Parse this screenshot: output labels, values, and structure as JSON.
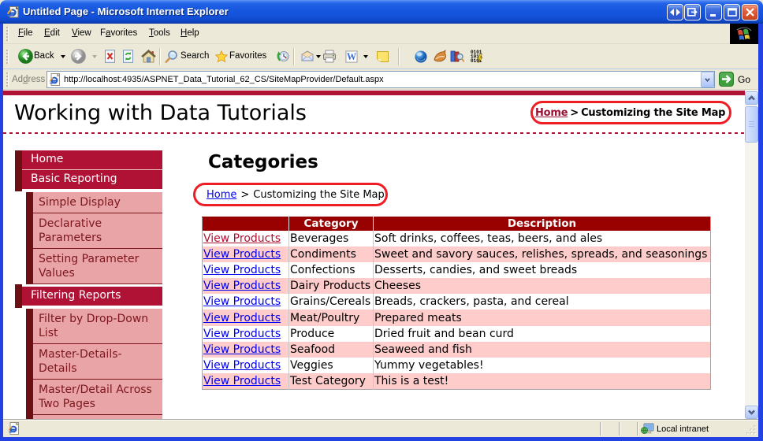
{
  "window": {
    "title": "Untitled Page - Microsoft Internet Explorer",
    "buttons": [
      "resize-horizontal",
      "detach",
      "minimize",
      "maximize",
      "close"
    ]
  },
  "menu": {
    "items": [
      {
        "label": "File",
        "accel": 0
      },
      {
        "label": "Edit",
        "accel": 0
      },
      {
        "label": "View",
        "accel": 0
      },
      {
        "label": "Favorites",
        "accel": 1
      },
      {
        "label": "Tools",
        "accel": 0
      },
      {
        "label": "Help",
        "accel": 0
      }
    ]
  },
  "toolbar": {
    "back_label": "Back",
    "search_label": "Search",
    "favorites_label": "Favorites"
  },
  "address": {
    "label": "Address",
    "label_accel": 2,
    "url": "http://localhost:4935/ASPNET_Data_Tutorial_62_CS/SiteMapProvider/Default.aspx",
    "go_label": "Go"
  },
  "page": {
    "site_title": "Working with Data Tutorials",
    "breadcrumb_top": {
      "home": "Home",
      "sep": ">",
      "current": "Customizing the Site Map"
    },
    "heading": "Categories",
    "breadcrumb_page": {
      "home": "Home",
      "sep": ">",
      "current": "Customizing the Site Map"
    },
    "sidebar": [
      {
        "label": "Home",
        "level": 1
      },
      {
        "label": "Basic Reporting",
        "level": 1
      },
      {
        "label": "Simple Display",
        "level": 2
      },
      {
        "label": "Declarative Parameters",
        "level": 2
      },
      {
        "label": "Setting Parameter Values",
        "level": 2
      },
      {
        "label": "Filtering Reports",
        "level": 1
      },
      {
        "label": "Filter by Drop-Down List",
        "level": 2
      },
      {
        "label": "Master-Details-Details",
        "level": 2
      },
      {
        "label": "Master/Detail Across Two Pages",
        "level": 2
      }
    ],
    "table": {
      "headers": [
        "",
        "Category",
        "Description"
      ],
      "link_label": "View Products",
      "rows": [
        {
          "category": "Beverages",
          "description": "Soft drinks, coffees, teas, beers, and ales",
          "visited": true
        },
        {
          "category": "Condiments",
          "description": "Sweet and savory sauces, relishes, spreads, and seasonings",
          "visited": false
        },
        {
          "category": "Confections",
          "description": "Desserts, candies, and sweet breads",
          "visited": false
        },
        {
          "category": "Dairy Products",
          "description": "Cheeses",
          "visited": false
        },
        {
          "category": "Grains/Cereals",
          "description": "Breads, crackers, pasta, and cereal",
          "visited": false
        },
        {
          "category": "Meat/Poultry",
          "description": "Prepared meats",
          "visited": false
        },
        {
          "category": "Produce",
          "description": "Dried fruit and bean curd",
          "visited": false
        },
        {
          "category": "Seafood",
          "description": "Seaweed and fish",
          "visited": false
        },
        {
          "category": "Veggies",
          "description": "Yummy vegetables!",
          "visited": false
        },
        {
          "category": "Test Category",
          "description": "This is a test!",
          "visited": false
        }
      ]
    }
  },
  "status": {
    "zone": "Local intranet"
  },
  "colors": {
    "crimson": "#B01236",
    "maroon_bar": "#6C1016",
    "pink_item": "#E9A4A8",
    "pink_text": "#7C161C",
    "table_header": "#990000",
    "alt_row": "#FFCCCC",
    "link": "#0000EE",
    "visited_link": "#AD1230",
    "annotation": "#EE1C25",
    "titlebar_blue": "#1758E0"
  }
}
